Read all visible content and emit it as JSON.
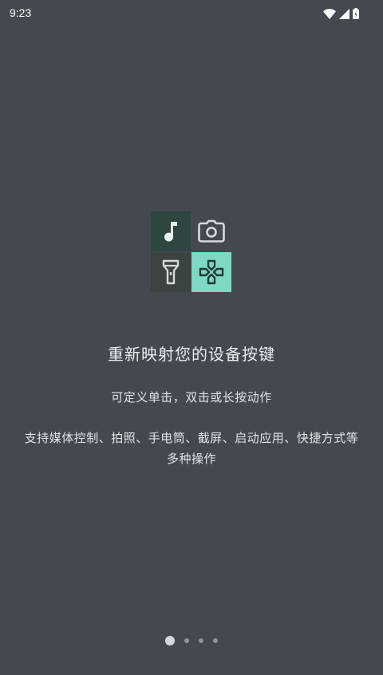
{
  "status_bar": {
    "time": "9:23"
  },
  "onboarding": {
    "icons": [
      "music-note-icon",
      "camera-icon",
      "flashlight-icon",
      "gamepad-icon"
    ],
    "title": "重新映射您的设备按键",
    "subtitle": "可定义单击，双击或长按动作",
    "description": "支持媒体控制、拍照、手电筒、截屏、启动应用、快捷方式等多种操作"
  },
  "pager": {
    "page_count": 4,
    "active_page": 1
  },
  "colors": {
    "background": "#444950",
    "accent": "#7dd8c4",
    "music_tile": "#2e4542"
  }
}
